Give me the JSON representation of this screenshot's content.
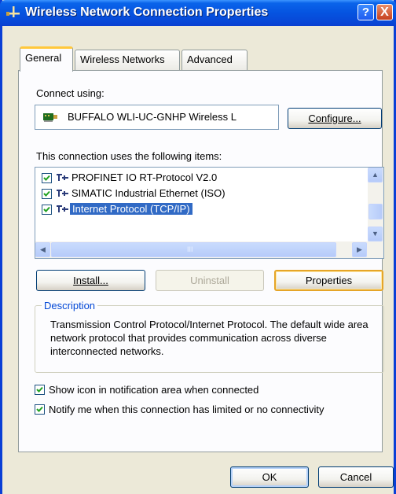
{
  "window": {
    "title": "Wireless Network Connection Properties",
    "help_label": "?",
    "close_label": "X"
  },
  "tabs": [
    {
      "label": "General",
      "active": true
    },
    {
      "label": "Wireless Networks",
      "active": false
    },
    {
      "label": "Advanced",
      "active": false
    }
  ],
  "connect_using": {
    "label": "Connect using:",
    "adapter_name": "BUFFALO WLI-UC-GNHP Wireless L",
    "configure_label": "Configure..."
  },
  "items": {
    "label": "This connection uses the following items:",
    "list": [
      {
        "label": "PROFINET IO RT-Protocol V2.0",
        "checked": true,
        "selected": false
      },
      {
        "label": "SIMATIC Industrial Ethernet (ISO)",
        "checked": true,
        "selected": false
      },
      {
        "label": "Internet Protocol (TCP/IP)",
        "checked": true,
        "selected": true
      }
    ],
    "hscroll_grip": "III"
  },
  "actions": {
    "install_label": "Install...",
    "uninstall_label": "Uninstall",
    "properties_label": "Properties"
  },
  "description": {
    "legend": "Description",
    "text": "Transmission Control Protocol/Internet Protocol. The default wide area network protocol that provides communication across diverse interconnected networks."
  },
  "options": [
    {
      "label": "Show icon in notification area when connected",
      "checked": true
    },
    {
      "label": "Notify me when this connection has limited or no connectivity",
      "checked": true
    }
  ],
  "footer": {
    "ok_label": "OK",
    "cancel_label": "Cancel"
  },
  "colors": {
    "titlebar": "#0553e0",
    "selection": "#316ac5",
    "default_button_border": "#e5a528",
    "group_legend": "#0046d5"
  }
}
